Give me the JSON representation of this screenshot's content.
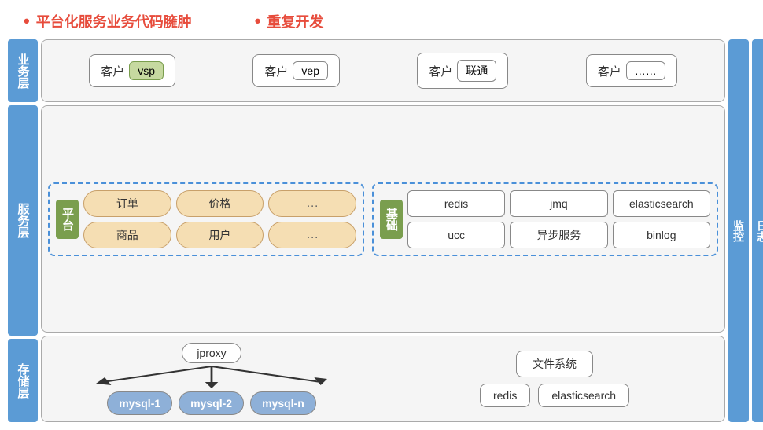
{
  "bullets": [
    {
      "text": "平台化服务业务代码臃肿",
      "highlight": true
    },
    {
      "text": "重复开发",
      "highlight": true
    }
  ],
  "layers": {
    "business": {
      "label": "业务层",
      "boxes": [
        {
          "client": "客户",
          "tag": "vsp",
          "tagStyle": "green"
        },
        {
          "client": "客户",
          "tag": "vep",
          "tagStyle": "plain"
        },
        {
          "client": "客户",
          "tag": "联通",
          "tagStyle": "plain"
        },
        {
          "client": "客户",
          "tag": "……",
          "tagStyle": "plain"
        }
      ]
    },
    "service": {
      "label": "服务层",
      "platform": {
        "label": "平台",
        "items": [
          "订单",
          "价格",
          "…",
          "商品",
          "用户",
          "…"
        ]
      },
      "foundation": {
        "label": "基础",
        "items": [
          "redis",
          "jmq",
          "elasticsearch",
          "ucc",
          "异步服务",
          "binlog"
        ]
      }
    },
    "storage": {
      "label": "存储层",
      "jproxy": {
        "label": "jproxy",
        "mysql_nodes": [
          "mysql-1",
          "mysql-2",
          "mysql-n"
        ]
      },
      "filesystem": {
        "label": "文件系统",
        "items": [
          "redis",
          "elasticsearch"
        ]
      }
    }
  },
  "right_labels": {
    "monitor": "监控",
    "log": "日志"
  }
}
